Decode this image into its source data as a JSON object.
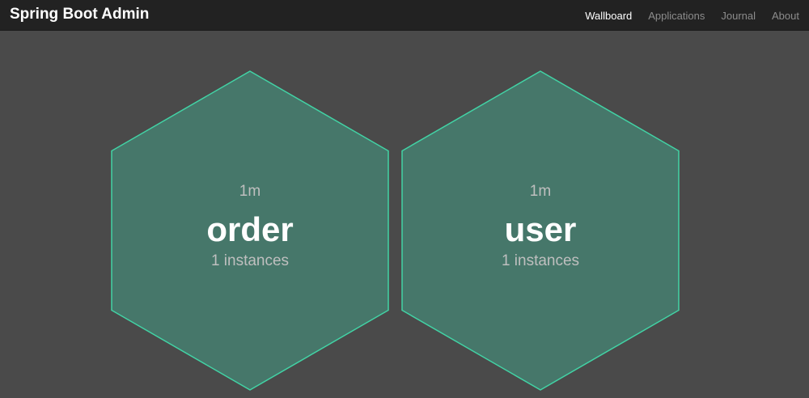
{
  "navbar": {
    "brand": "Spring Boot Admin",
    "items": [
      {
        "label": "Wallboard",
        "active": true
      },
      {
        "label": "Applications",
        "active": false
      },
      {
        "label": "Journal",
        "active": false
      },
      {
        "label": "About",
        "active": false
      }
    ]
  },
  "wallboard": {
    "tile_fill": "#46776a",
    "tile_stroke": "#42d3a5",
    "applications": [
      {
        "name": "order",
        "time": "1m",
        "instances": "1 instances",
        "status": "UP"
      },
      {
        "name": "user",
        "time": "1m",
        "instances": "1 instances",
        "status": "UP"
      }
    ]
  }
}
